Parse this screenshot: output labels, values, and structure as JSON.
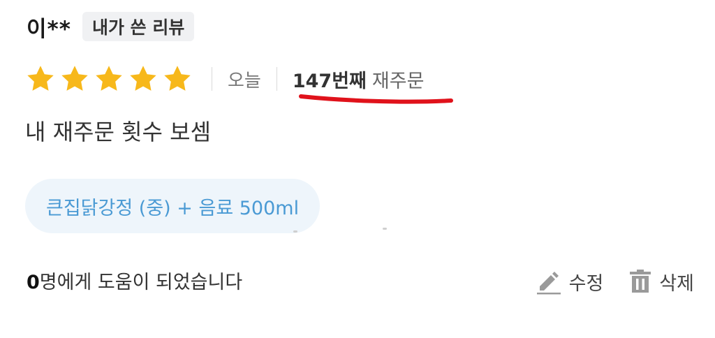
{
  "review": {
    "user": "이**",
    "badge": "내가 쓴 리뷰",
    "rating": 5,
    "rating_max": 5,
    "date": "오늘",
    "reorder_count": "147번째",
    "reorder_label": "재주문",
    "comment": "내 재주문 횟수 보셈",
    "menu": "큰집닭강정 (중) + 음료 500ml"
  },
  "footer": {
    "helpful_count": "0",
    "helpful_text": "명에게 도움이 되었습니다",
    "edit_label": "수정",
    "delete_label": "삭제"
  },
  "colors": {
    "star": "#f7b81b",
    "underline": "#e0121b",
    "menu_chip_bg": "#eef5fb",
    "menu_chip_text": "#4a9ad4"
  },
  "icons": {
    "rating": "star-icon",
    "edit": "pencil-icon",
    "delete": "trash-icon"
  }
}
